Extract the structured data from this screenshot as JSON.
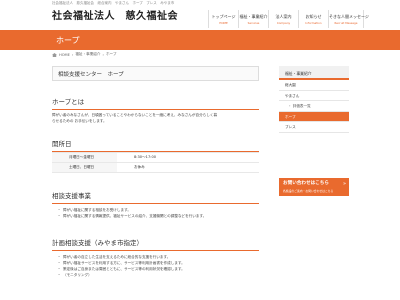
{
  "header": {
    "tagline": "社会福祉法人　慈久福祉会　総合案内　やまさん　ホープ　ブレス　みやま市",
    "logo": "社会福祉法人　慈久福祉会",
    "nav": [
      {
        "ja": "トップページ",
        "en": "HOME"
      },
      {
        "ja": "福祉・事業紹介",
        "en": "Services"
      },
      {
        "ja": "法人案内",
        "en": "Company"
      },
      {
        "ja": "お知らせ",
        "en": "Information"
      },
      {
        "ja": "そきな人間メッセージ",
        "en": "Recruit Message"
      }
    ]
  },
  "banner": {
    "title": "ホープ"
  },
  "breadcrumb": {
    "home": "HOME",
    "sep1": "›",
    "item1": "福祉・事業紹介",
    "sep2": "›",
    "item2": "ホープ"
  },
  "main": {
    "page_title": "相談支援センター　ホープ",
    "about": {
      "heading": "ホープとは",
      "text1": "障がい者のみなさんが、日頃困っていることやわからないことを一緒に考え、みなさんが自分らしく暮",
      "text2": "らせるための お手伝いをします。"
    },
    "hours": {
      "heading": "開所日",
      "rows": [
        {
          "label": "月曜日～金曜日",
          "value": "8:30～17:00"
        },
        {
          "label": "土曜日、日曜日",
          "value": "お休み"
        }
      ]
    },
    "consult": {
      "heading": "相談支援事業",
      "items": [
        "障がい福祉に関する相談をお受けします。",
        "障がい福祉に関する情報提供、福祉サービスの紹介、支援機関との調整などを行います。"
      ]
    },
    "plan": {
      "heading": "計画相談支援（みやま市指定）",
      "items": [
        "障がい者の自立した生活を支えるために総合的な支援を行います。",
        "障がい福祉サービスを利用する方に、サービス等利用計画書を作成します。",
        "策定後はご自身または周囲とともに、サービス等の利用状況を確認します。",
        "（モニタリング）"
      ]
    }
  },
  "sidebar": {
    "header": "福祉・事業紹介",
    "items": [
      {
        "label": "総大園",
        "sub": false,
        "active": false
      },
      {
        "label": "やまさん",
        "sub": false,
        "active": false
      },
      {
        "label": "・ 評価表一覧",
        "sub": true,
        "active": false
      },
      {
        "label": "ホープ",
        "sub": false,
        "active": true
      },
      {
        "label": "ブレス",
        "sub": false,
        "active": false
      }
    ],
    "contact": {
      "title": "お問い合わせはこちら",
      "subtitle": "各施設のご案内・お問い合わせはこちら",
      "arrow": "»"
    }
  },
  "colors": {
    "accent": "#e96a2e"
  }
}
